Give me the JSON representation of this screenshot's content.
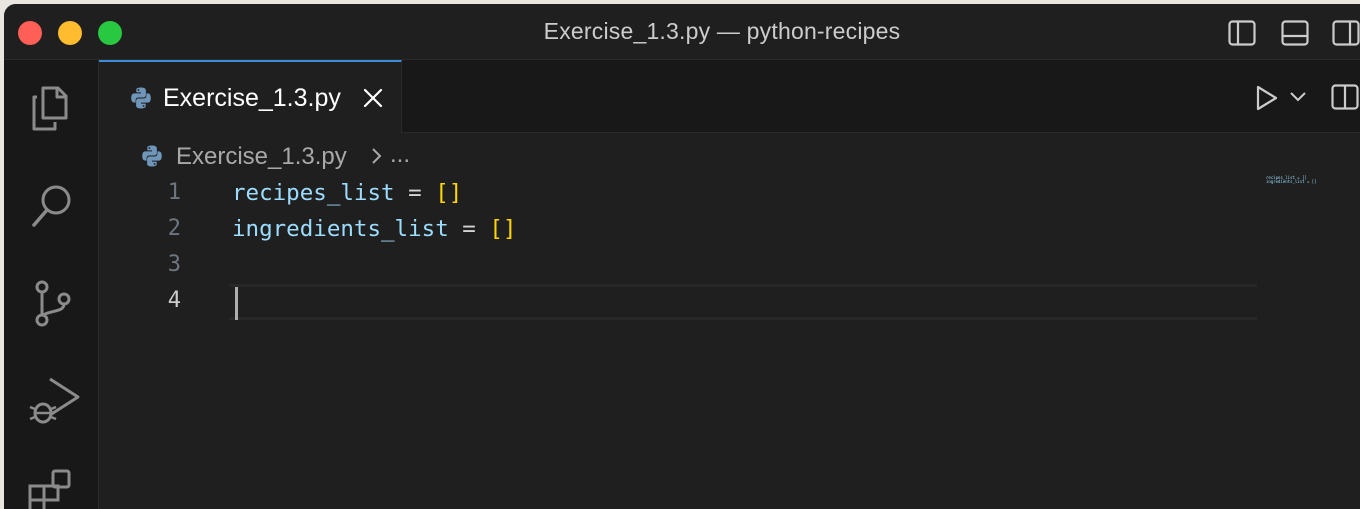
{
  "window": {
    "title": "Exercise_1.3.py — python-recipes"
  },
  "activity_bar": {
    "items": [
      {
        "name": "explorer",
        "icon": "files-icon"
      },
      {
        "name": "search",
        "icon": "search-icon"
      },
      {
        "name": "source-control",
        "icon": "source-control-icon"
      },
      {
        "name": "run-and-debug",
        "icon": "run-debug-icon"
      },
      {
        "name": "extensions",
        "icon": "extensions-icon"
      }
    ]
  },
  "tabs": [
    {
      "label": "Exercise_1.3.py",
      "icon": "python-icon",
      "active": true
    }
  ],
  "breadcrumb": {
    "file": "Exercise_1.3.py",
    "ellipsis": "..."
  },
  "editor": {
    "lines": [
      {
        "number": "1",
        "var": "recipes_list",
        "op": " = ",
        "value": "[]"
      },
      {
        "number": "2",
        "var": "ingredients_list",
        "op": " = ",
        "value": "[]"
      },
      {
        "number": "3",
        "var": "",
        "op": "",
        "value": ""
      },
      {
        "number": "4",
        "var": "",
        "op": "",
        "value": ""
      }
    ],
    "active_line": "4"
  },
  "minimap": {
    "lines": [
      "recipes_list = []",
      "ingredients_list = []"
    ]
  },
  "colors": {
    "accent": "#3c8fd6",
    "variable": "#9cdcfe",
    "bracket": "#ffd700",
    "close": "#ff5f57",
    "minimize": "#febc2e",
    "zoom": "#28c840"
  }
}
